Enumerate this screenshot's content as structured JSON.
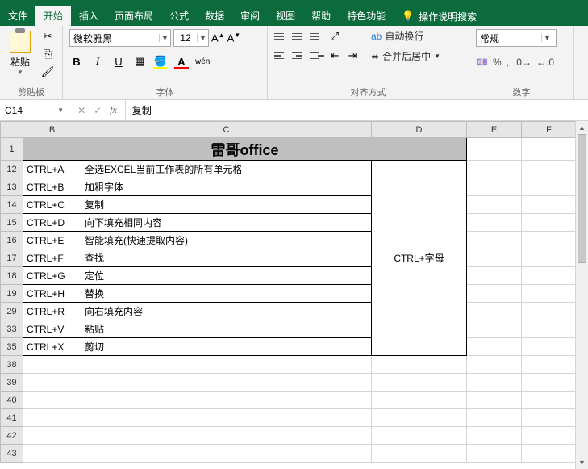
{
  "tabs": [
    "文件",
    "开始",
    "插入",
    "页面布局",
    "公式",
    "数据",
    "审阅",
    "视图",
    "帮助",
    "特色功能"
  ],
  "activeTab": 1,
  "tellMe": "操作说明搜索",
  "ribbon": {
    "clipboard": {
      "paste": "粘贴",
      "label": "剪贴板"
    },
    "font": {
      "name": "微软雅黑",
      "size": "12",
      "label": "字体",
      "bold": "B",
      "italic": "I",
      "underline": "U",
      "wen": "wén"
    },
    "align": {
      "label": "对齐方式",
      "wrap": "自动换行",
      "merge": "合并后居中"
    },
    "number": {
      "label": "数字",
      "format": "常规",
      "percent": "%"
    }
  },
  "nameBox": "C14",
  "formulaBar": "复制",
  "columns": [
    "B",
    "C",
    "D",
    "E",
    "F"
  ],
  "titleText": "雷哥office",
  "mergeD": "CTRL+字母",
  "rows": [
    {
      "n": "12",
      "b": "CTRL+A",
      "c": "全选EXCEL当前工作表的所有单元格"
    },
    {
      "n": "13",
      "b": "CTRL+B",
      "c": "加粗字体"
    },
    {
      "n": "14",
      "b": "CTRL+C",
      "c": "复制"
    },
    {
      "n": "15",
      "b": "CTRL+D",
      "c": "向下填充相同内容"
    },
    {
      "n": "16",
      "b": "CTRL+E",
      "c": "智能填充(快速提取内容)"
    },
    {
      "n": "17",
      "b": "CTRL+F",
      "c": "查找"
    },
    {
      "n": "18",
      "b": "CTRL+G",
      "c": "定位"
    },
    {
      "n": "19",
      "b": "CTRL+H",
      "c": "替换"
    },
    {
      "n": "29",
      "b": "CTRL+R",
      "c": "向右填充内容"
    },
    {
      "n": "33",
      "b": "CTRL+V",
      "c": "粘贴"
    },
    {
      "n": "35",
      "b": "CTRL+X",
      "c": "剪切"
    }
  ],
  "emptyRows": [
    "38",
    "39",
    "40",
    "41",
    "42",
    "43"
  ]
}
